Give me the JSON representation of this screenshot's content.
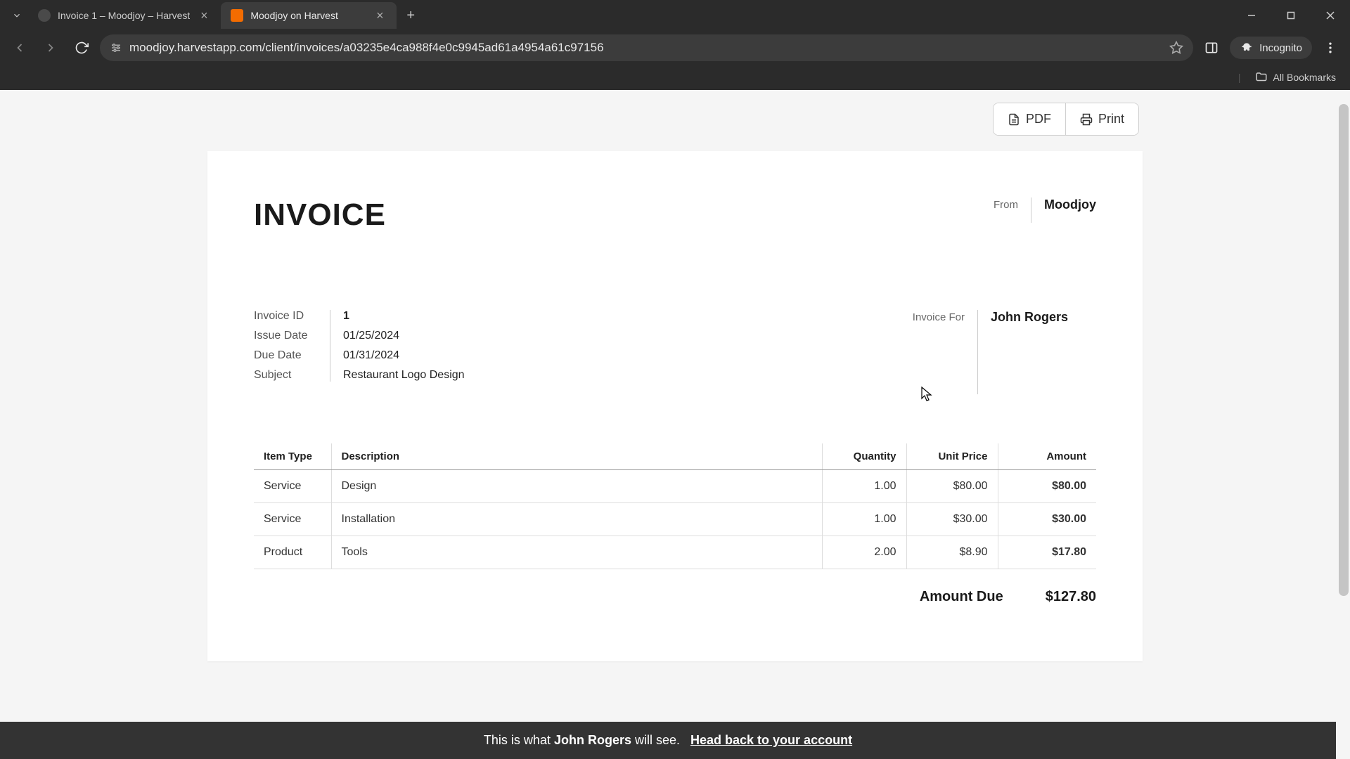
{
  "browser": {
    "tabs": [
      {
        "title": "Invoice 1 – Moodjoy – Harvest",
        "active": false
      },
      {
        "title": "Moodjoy on Harvest",
        "active": true
      }
    ],
    "url": "moodjoy.harvestapp.com/client/invoices/a03235e4ca988f4e0c9945ad61a4954a61c97156",
    "incognito_label": "Incognito",
    "all_bookmarks": "All Bookmarks"
  },
  "toolbar": {
    "pdf_label": "PDF",
    "print_label": "Print"
  },
  "invoice": {
    "heading": "INVOICE",
    "from_label": "From",
    "from_name": "Moodjoy",
    "for_label": "Invoice For",
    "for_name": "John Rogers",
    "meta_labels": {
      "id": "Invoice ID",
      "issue": "Issue Date",
      "due": "Due Date",
      "subject": "Subject"
    },
    "meta_values": {
      "id": "1",
      "issue": "01/25/2024",
      "due": "01/31/2024",
      "subject": "Restaurant Logo Design"
    },
    "columns": {
      "type": "Item Type",
      "desc": "Description",
      "qty": "Quantity",
      "price": "Unit Price",
      "amount": "Amount"
    },
    "items": [
      {
        "type": "Service",
        "desc": "Design",
        "qty": "1.00",
        "price": "$80.00",
        "amount": "$80.00"
      },
      {
        "type": "Service",
        "desc": "Installation",
        "qty": "1.00",
        "price": "$30.00",
        "amount": "$30.00"
      },
      {
        "type": "Product",
        "desc": "Tools",
        "qty": "2.00",
        "price": "$8.90",
        "amount": "$17.80"
      }
    ],
    "amount_due_label": "Amount Due",
    "amount_due_value": "$127.80"
  },
  "footer": {
    "prefix": "This is what ",
    "name": "John Rogers",
    "suffix": " will see.",
    "link": "Head back to your account"
  }
}
